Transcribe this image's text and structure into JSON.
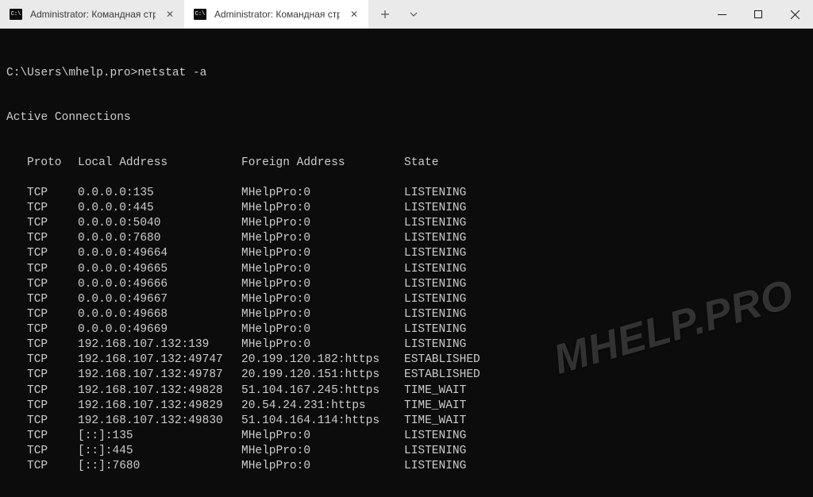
{
  "titlebar": {
    "tabs": [
      {
        "title": "Administrator: Командная стро",
        "active": false
      },
      {
        "title": "Administrator: Командная стро",
        "active": true
      }
    ],
    "new_tab_tooltip": "+",
    "dropdown_tooltip": "⌄"
  },
  "terminal": {
    "prompt": "C:\\Users\\mhelp.pro>netstat -a",
    "section": "Active Connections",
    "headers": {
      "proto": "Proto",
      "local": "Local Address",
      "foreign": "Foreign Address",
      "state": "State"
    },
    "rows": [
      {
        "proto": "TCP",
        "local": "0.0.0.0:135",
        "foreign": "MHelpPro:0",
        "state": "LISTENING"
      },
      {
        "proto": "TCP",
        "local": "0.0.0.0:445",
        "foreign": "MHelpPro:0",
        "state": "LISTENING"
      },
      {
        "proto": "TCP",
        "local": "0.0.0.0:5040",
        "foreign": "MHelpPro:0",
        "state": "LISTENING"
      },
      {
        "proto": "TCP",
        "local": "0.0.0.0:7680",
        "foreign": "MHelpPro:0",
        "state": "LISTENING"
      },
      {
        "proto": "TCP",
        "local": "0.0.0.0:49664",
        "foreign": "MHelpPro:0",
        "state": "LISTENING"
      },
      {
        "proto": "TCP",
        "local": "0.0.0.0:49665",
        "foreign": "MHelpPro:0",
        "state": "LISTENING"
      },
      {
        "proto": "TCP",
        "local": "0.0.0.0:49666",
        "foreign": "MHelpPro:0",
        "state": "LISTENING"
      },
      {
        "proto": "TCP",
        "local": "0.0.0.0:49667",
        "foreign": "MHelpPro:0",
        "state": "LISTENING"
      },
      {
        "proto": "TCP",
        "local": "0.0.0.0:49668",
        "foreign": "MHelpPro:0",
        "state": "LISTENING"
      },
      {
        "proto": "TCP",
        "local": "0.0.0.0:49669",
        "foreign": "MHelpPro:0",
        "state": "LISTENING"
      },
      {
        "proto": "TCP",
        "local": "192.168.107.132:139",
        "foreign": "MHelpPro:0",
        "state": "LISTENING"
      },
      {
        "proto": "TCP",
        "local": "192.168.107.132:49747",
        "foreign": "20.199.120.182:https",
        "state": "ESTABLISHED"
      },
      {
        "proto": "TCP",
        "local": "192.168.107.132:49787",
        "foreign": "20.199.120.151:https",
        "state": "ESTABLISHED"
      },
      {
        "proto": "TCP",
        "local": "192.168.107.132:49828",
        "foreign": "51.104.167.245:https",
        "state": "TIME_WAIT"
      },
      {
        "proto": "TCP",
        "local": "192.168.107.132:49829",
        "foreign": "20.54.24.231:https",
        "state": "TIME_WAIT"
      },
      {
        "proto": "TCP",
        "local": "192.168.107.132:49830",
        "foreign": "51.104.164.114:https",
        "state": "TIME_WAIT"
      },
      {
        "proto": "TCP",
        "local": "[::]:135",
        "foreign": "MHelpPro:0",
        "state": "LISTENING"
      },
      {
        "proto": "TCP",
        "local": "[::]:445",
        "foreign": "MHelpPro:0",
        "state": "LISTENING"
      },
      {
        "proto": "TCP",
        "local": "[::]:7680",
        "foreign": "MHelpPro:0",
        "state": "LISTENING"
      }
    ]
  },
  "watermark": "MHELP.PRO"
}
